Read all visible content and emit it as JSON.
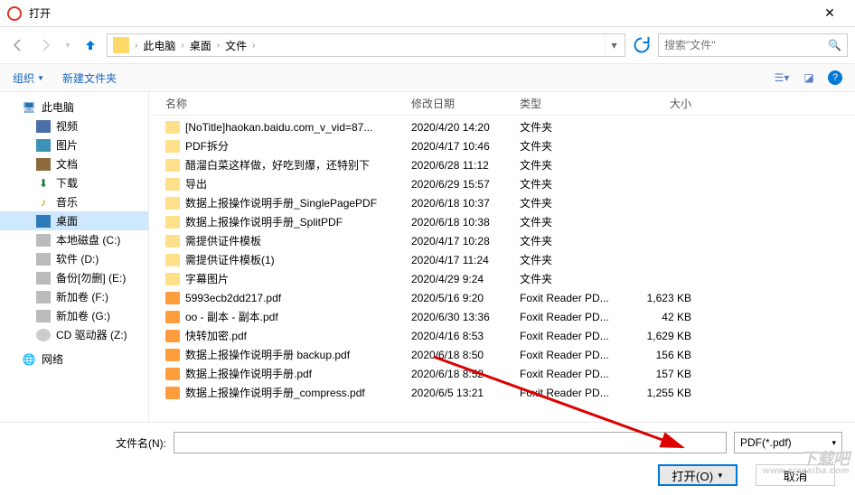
{
  "title": "打开",
  "breadcrumbs": [
    "此电脑",
    "桌面",
    "文件"
  ],
  "search_placeholder": "搜索\"文件\"",
  "toolbar": {
    "organize": "组织",
    "newfolder": "新建文件夹"
  },
  "columns": {
    "name": "名称",
    "date": "修改日期",
    "type": "类型",
    "size": "大小"
  },
  "sidebar": {
    "pc": "此电脑",
    "video": "视频",
    "pictures": "图片",
    "documents": "文档",
    "downloads": "下载",
    "music": "音乐",
    "desktop": "桌面",
    "diskc": "本地磁盘 (C:)",
    "diskd": "软件 (D:)",
    "diske": "备份[勿删] (E:)",
    "diskf": "新加卷 (F:)",
    "diskg": "新加卷 (G:)",
    "cdz": "CD 驱动器 (Z:)",
    "network": "网络"
  },
  "files": [
    {
      "icon": "folder",
      "name": "[NoTitle]haokan.baidu.com_v_vid=87...",
      "date": "2020/4/20 14:20",
      "type": "文件夹",
      "size": ""
    },
    {
      "icon": "folder",
      "name": "PDF拆分",
      "date": "2020/4/17 10:46",
      "type": "文件夹",
      "size": ""
    },
    {
      "icon": "folder",
      "name": "醋溜白菜这样做，好吃到爆，还特别下",
      "date": "2020/6/28 11:12",
      "type": "文件夹",
      "size": ""
    },
    {
      "icon": "folder",
      "name": "导出",
      "date": "2020/6/29 15:57",
      "type": "文件夹",
      "size": ""
    },
    {
      "icon": "folder",
      "name": "数据上报操作说明手册_SinglePagePDF",
      "date": "2020/6/18 10:37",
      "type": "文件夹",
      "size": ""
    },
    {
      "icon": "folder",
      "name": "数据上报操作说明手册_SplitPDF",
      "date": "2020/6/18 10:38",
      "type": "文件夹",
      "size": ""
    },
    {
      "icon": "folder",
      "name": "需提供证件模板",
      "date": "2020/4/17 10:28",
      "type": "文件夹",
      "size": ""
    },
    {
      "icon": "folder",
      "name": "需提供证件模板(1)",
      "date": "2020/4/17 11:24",
      "type": "文件夹",
      "size": ""
    },
    {
      "icon": "folder",
      "name": "字幕图片",
      "date": "2020/4/29 9:24",
      "type": "文件夹",
      "size": ""
    },
    {
      "icon": "pdf",
      "name": "5993ecb2dd217.pdf",
      "date": "2020/5/16 9:20",
      "type": "Foxit Reader PD...",
      "size": "1,623 KB"
    },
    {
      "icon": "pdf",
      "name": "oo - 副本 - 副本.pdf",
      "date": "2020/6/30 13:36",
      "type": "Foxit Reader PD...",
      "size": "42 KB"
    },
    {
      "icon": "pdf",
      "name": "快转加密.pdf",
      "date": "2020/4/16 8:53",
      "type": "Foxit Reader PD...",
      "size": "1,629 KB"
    },
    {
      "icon": "pdf",
      "name": "数据上报操作说明手册 backup.pdf",
      "date": "2020/6/18 8:50",
      "type": "Foxit Reader PD...",
      "size": "156 KB"
    },
    {
      "icon": "pdf",
      "name": "数据上报操作说明手册.pdf",
      "date": "2020/6/18 8:52",
      "type": "Foxit Reader PD...",
      "size": "157 KB"
    },
    {
      "icon": "pdf",
      "name": "数据上报操作说明手册_compress.pdf",
      "date": "2020/6/5 13:21",
      "type": "Foxit Reader PD...",
      "size": "1,255 KB"
    }
  ],
  "footer": {
    "filename_label": "文件名(N):",
    "filter": "PDF(*.pdf)",
    "open": "打开(O)",
    "cancel": "取消"
  },
  "watermark": {
    "main": "下载吧",
    "sub": "www.xiazaiba.com"
  }
}
